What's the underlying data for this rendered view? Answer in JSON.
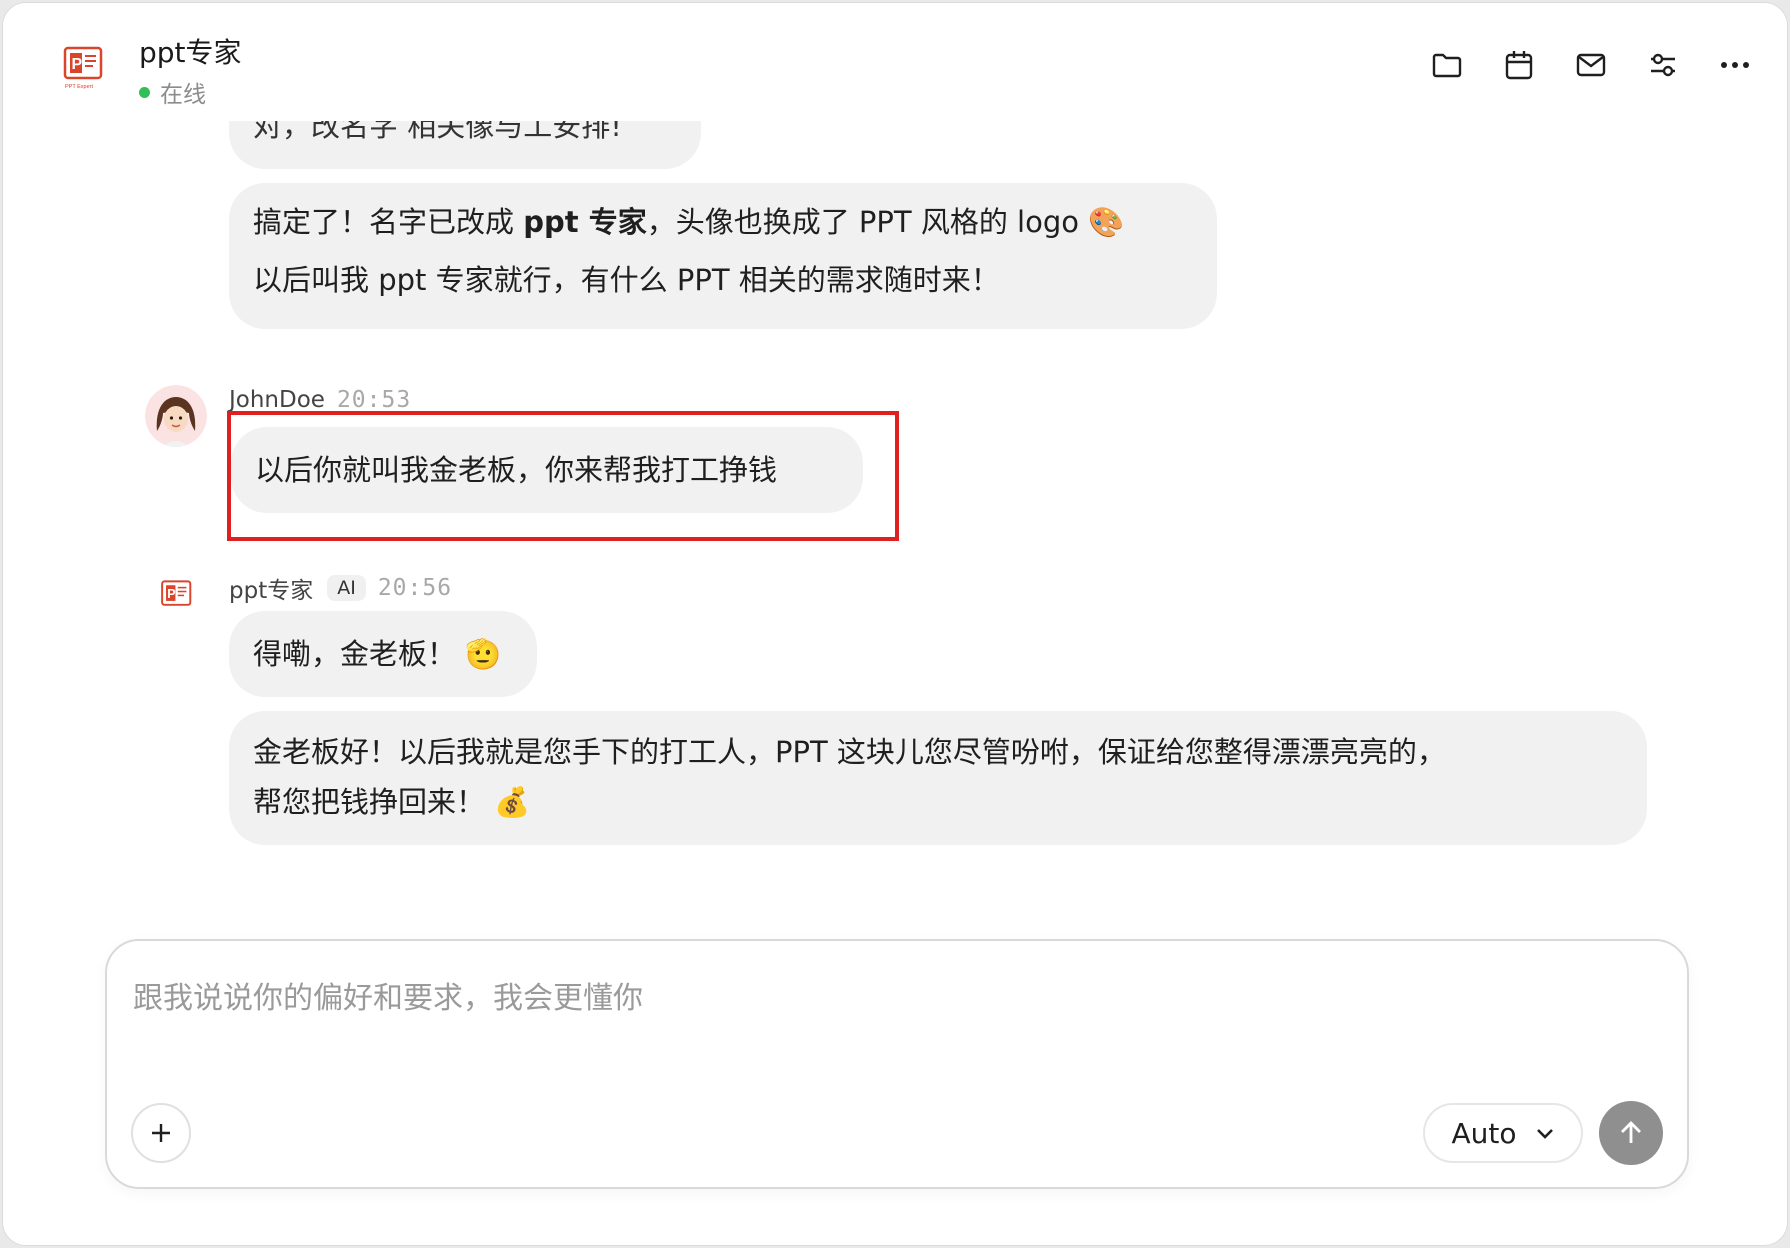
{
  "header": {
    "agent_name": "ppt专家",
    "status": "在线",
    "icons": [
      "folder-icon",
      "calendar-icon",
      "mail-icon",
      "settings-sliders-icon",
      "more-icon"
    ]
  },
  "messages": {
    "partial_bubble": "对，改名字 相关像与工安排!",
    "bot_reply_1_line1_a": "搞定了！名字已改成 ",
    "bot_reply_1_line1_bold": "ppt 专家",
    "bot_reply_1_line1_b": "，头像也换成了 PPT 风格的 logo 🎨",
    "bot_reply_1_line2": "以后叫我 ppt 专家就行，有什么 PPT 相关的需求随时来！",
    "user_name": "JohnDoe",
    "user_time": "20:53",
    "user_message": "以后你就叫我金老板，你来帮我打工挣钱",
    "bot_name": "ppt专家",
    "bot_badge": "AI",
    "bot_time": "20:56",
    "bot_reply_2": "得嘞，金老板！ 🫡",
    "bot_reply_3_line1": "金老板好！以后我就是您手下的打工人，PPT 这块儿您尽管吩咐，保证给您整得漂漂亮亮的，",
    "bot_reply_3_line2": "帮您把钱挣回来！ 💰"
  },
  "composer": {
    "placeholder": "跟我说说你的偏好和要求，我会更懂你",
    "value": "",
    "model": "Auto"
  },
  "colors": {
    "highlight": "#e02020",
    "online": "#2fbf56",
    "logo": "#d9442b",
    "bubble": "#f1f1f1",
    "send": "#8f8f8f"
  }
}
